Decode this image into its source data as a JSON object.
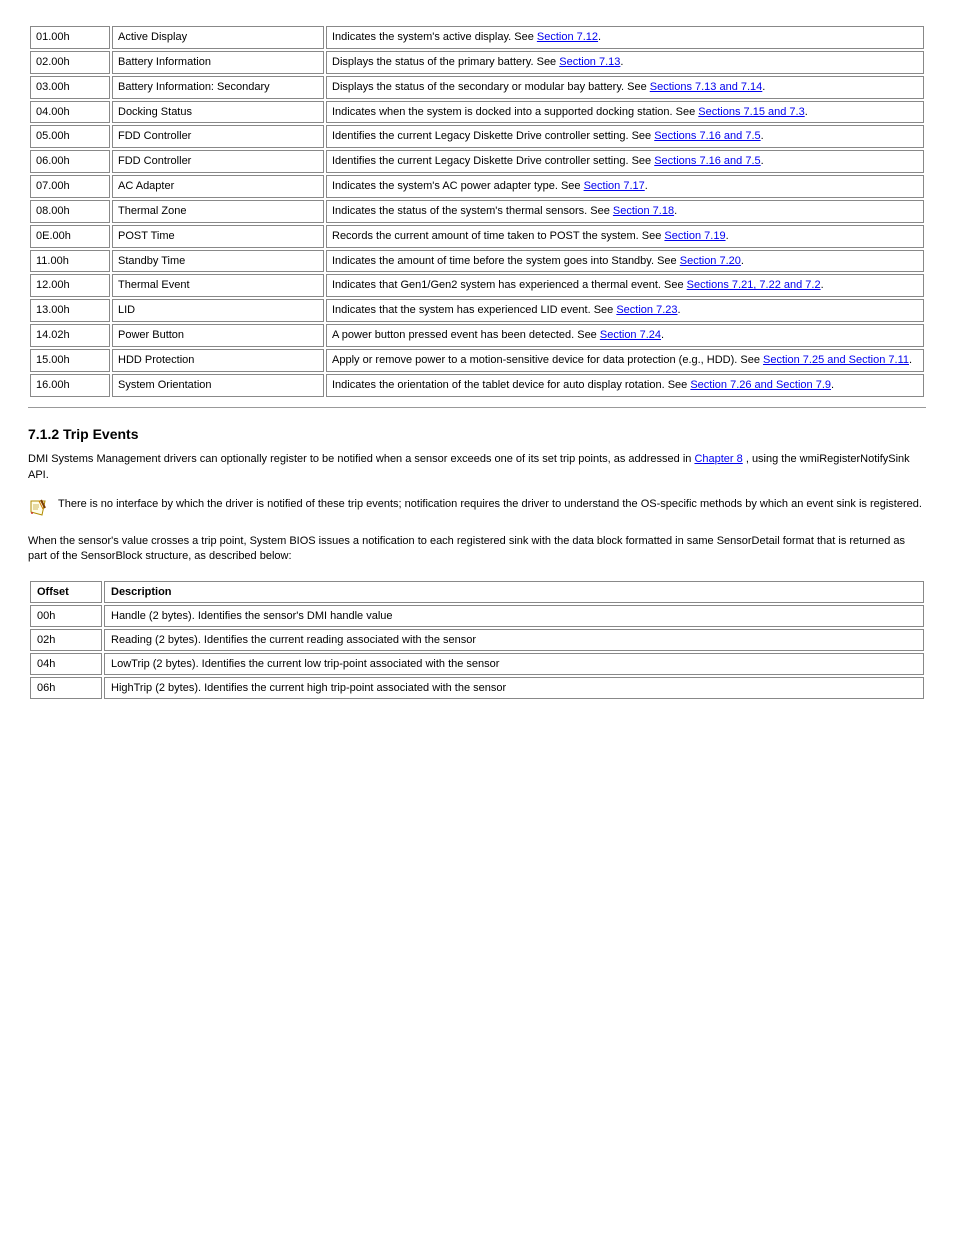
{
  "table1": {
    "rows": [
      {
        "c1": "01.00h",
        "c2": "Active Display",
        "pre": "Indicates the system's active display. See ",
        "link": "Section 7.12",
        "post": "."
      },
      {
        "c1": "02.00h",
        "c2": "Battery Information",
        "pre": "Displays the status of the primary battery. See ",
        "link": "Section 7.13",
        "post": "."
      },
      {
        "c1": "03.00h",
        "c2": "Battery Information: Secondary",
        "pre": "Displays the status of the secondary or modular bay battery. See ",
        "link": "Sections 7.13 and 7.14",
        "post": "."
      },
      {
        "c1": "04.00h",
        "c2": "Docking Status",
        "pre": "Indicates when the system is docked into a supported docking station. See ",
        "link": "Sections 7.15 and 7.3",
        "post": "."
      },
      {
        "c1": "05.00h",
        "c2": "FDD Controller",
        "pre": "Identifies the current Legacy Diskette Drive controller setting. See ",
        "link": "Sections 7.16 and 7.5",
        "post": "."
      },
      {
        "c1": "06.00h",
        "c2": "FDD Controller",
        "pre": "Identifies the current Legacy Diskette Drive controller setting. See ",
        "link": "Sections 7.16 and 7.5",
        "post": "."
      },
      {
        "c1": "07.00h",
        "c2": "AC Adapter",
        "pre": "Indicates the system's AC power adapter type. See ",
        "link": "Section 7.17",
        "post": "."
      },
      {
        "c1": "08.00h",
        "c2": "Thermal Zone",
        "pre": "Indicates the status of the system's thermal sensors. See ",
        "link": "Section 7.18",
        "post": "."
      },
      {
        "c1": "0E.00h",
        "c2": "POST Time",
        "pre": "Records the current amount of time taken to POST the system. See ",
        "link": "Section 7.19",
        "post": "."
      },
      {
        "c1": "11.00h",
        "c2": "Standby Time",
        "pre": "Indicates the amount of time before the system goes into Standby. See ",
        "link": "Section 7.20",
        "post": "."
      },
      {
        "c1": "12.00h",
        "c2": "Thermal Event",
        "pre": "Indicates that Gen1/Gen2 system has experienced a thermal event. See ",
        "link": "Sections 7.21, 7.22 and 7.2",
        "post": "."
      },
      {
        "c1": "13.00h",
        "c2": "LID",
        "pre": "Indicates that the system has experienced LID event. See ",
        "link": "Section 7.23",
        "post": "."
      },
      {
        "c1": "14.02h",
        "c2": "Power Button",
        "pre": "A power button pressed event has been detected. See ",
        "link": "Section 7.24",
        "post": "."
      },
      {
        "c1": "15.00h",
        "c2": "HDD Protection",
        "pre": "Apply or remove power to a motion-sensitive device for data protection (e.g., HDD). See ",
        "link": "Section 7.25 and Section 7.11",
        "post": "."
      },
      {
        "c1": "16.00h",
        "c2": "System Orientation",
        "pre": "Indicates the orientation of the tablet device for auto display rotation. See ",
        "link": "Section 7.26 and Section 7.9",
        "post": "."
      }
    ]
  },
  "section": {
    "heading": "7.1.2 Trip Events",
    "p1_pre": "DMI Systems Management drivers can optionally register to be notified when a sensor exceeds one of its set trip points, as addressed in ",
    "p1_link": "Chapter 8",
    "p1_post": ", using the wmiRegisterNotifySink API.",
    "note_text": "There is no interface by which the driver is notified of these trip events; notification requires the driver to understand the OS-specific methods by which an event sink is registered.",
    "p2": "When the sensor's value crosses a trip point, System BIOS issues a notification to each registered sink with the data block formatted in same SensorDetail format that is returned as part of the SensorBlock structure, as described below:"
  },
  "table2": {
    "headers": {
      "c1": "Offset",
      "c2": "Description"
    },
    "rows": [
      {
        "c1": "00h",
        "c2": "Handle (2 bytes). Identifies the sensor's DMI handle value"
      },
      {
        "c1": "02h",
        "c2": "Reading (2 bytes). Identifies the current reading associated with the sensor"
      },
      {
        "c1": "04h",
        "c2": "LowTrip (2 bytes). Identifies the current low trip-point associated with the sensor"
      },
      {
        "c1": "06h",
        "c2": "HighTrip (2 bytes). Identifies the current high trip-point associated with the sensor"
      }
    ]
  }
}
